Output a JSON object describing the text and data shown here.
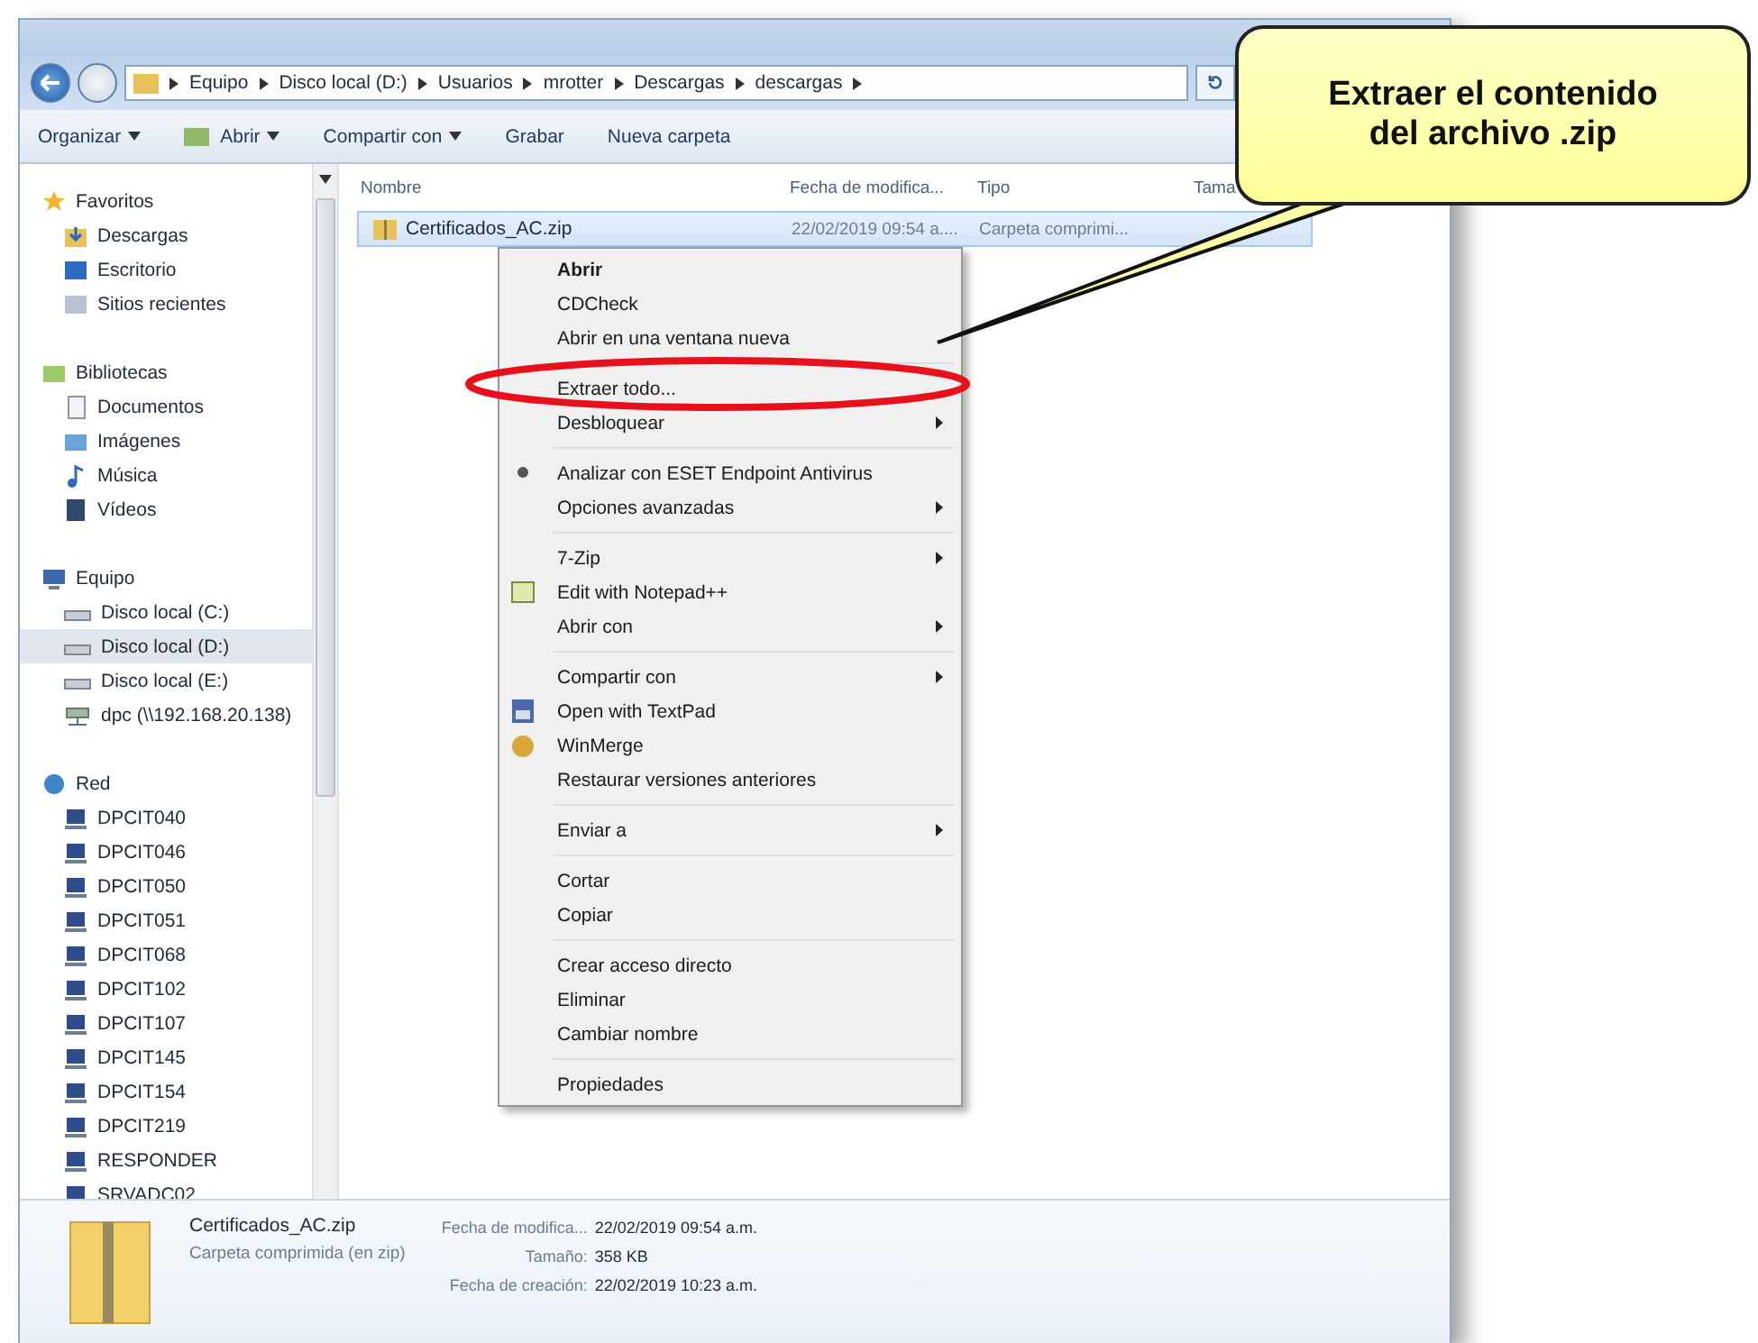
{
  "address_bar": {
    "path": [
      "Equipo",
      "Disco local (D:)",
      "Usuarios",
      "mrotter",
      "Descargas",
      "descargas"
    ]
  },
  "toolbar": [
    {
      "label": "Organizar",
      "dropdown": true
    },
    {
      "label": "Abrir",
      "dropdown": true
    },
    {
      "label": "Compartir con",
      "dropdown": true
    },
    {
      "label": "Grabar",
      "dropdown": false
    },
    {
      "label": "Nueva carpeta",
      "dropdown": false
    }
  ],
  "sidebar": {
    "groups": [
      {
        "label": "Favoritos",
        "children": [
          {
            "label": "Descargas",
            "selected": false
          },
          {
            "label": "Escritorio",
            "selected": false
          },
          {
            "label": "Sitios recientes",
            "selected": false
          }
        ]
      },
      {
        "label": "Bibliotecas",
        "children": [
          {
            "label": "Documentos",
            "selected": false
          },
          {
            "label": "Imágenes",
            "selected": false
          },
          {
            "label": "Música",
            "selected": false
          },
          {
            "label": "Vídeos",
            "selected": false
          }
        ]
      },
      {
        "label": "Equipo",
        "children": [
          {
            "label": "Disco local (C:)",
            "selected": false
          },
          {
            "label": "Disco local (D:)",
            "selected": true
          },
          {
            "label": "Disco local (E:)",
            "selected": false
          },
          {
            "label": "dpc (\\\\192.168.20.138)",
            "selected": false
          }
        ]
      },
      {
        "label": "Red",
        "children": [
          {
            "label": "DPCIT040",
            "selected": false
          },
          {
            "label": "DPCIT046",
            "selected": false
          },
          {
            "label": "DPCIT050",
            "selected": false
          },
          {
            "label": "DPCIT051",
            "selected": false
          },
          {
            "label": "DPCIT068",
            "selected": false
          },
          {
            "label": "DPCIT102",
            "selected": false
          },
          {
            "label": "DPCIT107",
            "selected": false
          },
          {
            "label": "DPCIT145",
            "selected": false
          },
          {
            "label": "DPCIT154",
            "selected": false
          },
          {
            "label": "DPCIT219",
            "selected": false
          },
          {
            "label": "RESPONDER",
            "selected": false
          },
          {
            "label": "SRVADC02",
            "selected": false
          }
        ]
      }
    ]
  },
  "file_list": {
    "columns": [
      "Nombre",
      "Fecha de modifica...",
      "Tipo",
      "Tama"
    ],
    "rows": [
      {
        "name": "Certificados_AC.zip",
        "date": "22/02/2019 09:54 a....",
        "type": "Carpeta comprimi...",
        "selected": true
      }
    ]
  },
  "context_menu": [
    {
      "kind": "item",
      "label": "Abrir",
      "bold": true,
      "submenu": false,
      "circled": false
    },
    {
      "kind": "item",
      "label": "CDCheck",
      "bold": false,
      "submenu": false,
      "circled": false
    },
    {
      "kind": "item",
      "label": "Abrir en una ventana nueva",
      "bold": false,
      "submenu": false,
      "circled": false
    },
    {
      "kind": "separator"
    },
    {
      "kind": "item",
      "label": "Extraer todo...",
      "bold": false,
      "submenu": false,
      "circled": true
    },
    {
      "kind": "item",
      "label": "Desbloquear",
      "bold": false,
      "submenu": true,
      "circled": false
    },
    {
      "kind": "separator"
    },
    {
      "kind": "item",
      "label": "Analizar con ESET Endpoint Antivirus",
      "bold": false,
      "submenu": false,
      "circled": false
    },
    {
      "kind": "item",
      "label": "Opciones avanzadas",
      "bold": false,
      "submenu": true,
      "circled": false
    },
    {
      "kind": "separator"
    },
    {
      "kind": "item",
      "label": "7-Zip",
      "bold": false,
      "submenu": true,
      "circled": false
    },
    {
      "kind": "item",
      "label": "Edit with Notepad++",
      "bold": false,
      "submenu": false,
      "circled": false
    },
    {
      "kind": "item",
      "label": "Abrir con",
      "bold": false,
      "submenu": true,
      "circled": false
    },
    {
      "kind": "separator"
    },
    {
      "kind": "item",
      "label": "Compartir con",
      "bold": false,
      "submenu": true,
      "circled": false
    },
    {
      "kind": "item",
      "label": "Open with TextPad",
      "bold": false,
      "submenu": false,
      "circled": false
    },
    {
      "kind": "item",
      "label": "WinMerge",
      "bold": false,
      "submenu": false,
      "circled": false
    },
    {
      "kind": "item",
      "label": "Restaurar versiones anteriores",
      "bold": false,
      "submenu": false,
      "circled": false
    },
    {
      "kind": "separator"
    },
    {
      "kind": "item",
      "label": "Enviar a",
      "bold": false,
      "submenu": true,
      "circled": false
    },
    {
      "kind": "separator"
    },
    {
      "kind": "item",
      "label": "Cortar",
      "bold": false,
      "submenu": false,
      "circled": false
    },
    {
      "kind": "item",
      "label": "Copiar",
      "bold": false,
      "submenu": false,
      "circled": false
    },
    {
      "kind": "separator"
    },
    {
      "kind": "item",
      "label": "Crear acceso directo",
      "bold": false,
      "submenu": false,
      "circled": false
    },
    {
      "kind": "item",
      "label": "Eliminar",
      "bold": false,
      "submenu": false,
      "circled": false
    },
    {
      "kind": "item",
      "label": "Cambiar nombre",
      "bold": false,
      "submenu": false,
      "circled": false
    },
    {
      "kind": "separator"
    },
    {
      "kind": "item",
      "label": "Propiedades",
      "bold": false,
      "submenu": false,
      "circled": false
    }
  ],
  "details": {
    "name": "Certificados_AC.zip",
    "type": "Carpeta comprimida (en zip)",
    "fields": [
      {
        "label": "Fecha de modifica...",
        "value": "22/02/2019 09:54 a.m."
      },
      {
        "label": "Tamaño:",
        "value": "358 KB"
      },
      {
        "label": "Fecha de creación:",
        "value": "22/02/2019 10:23 a.m."
      }
    ]
  },
  "callout": {
    "text": "Extraer el contenido del archivo .zip"
  }
}
